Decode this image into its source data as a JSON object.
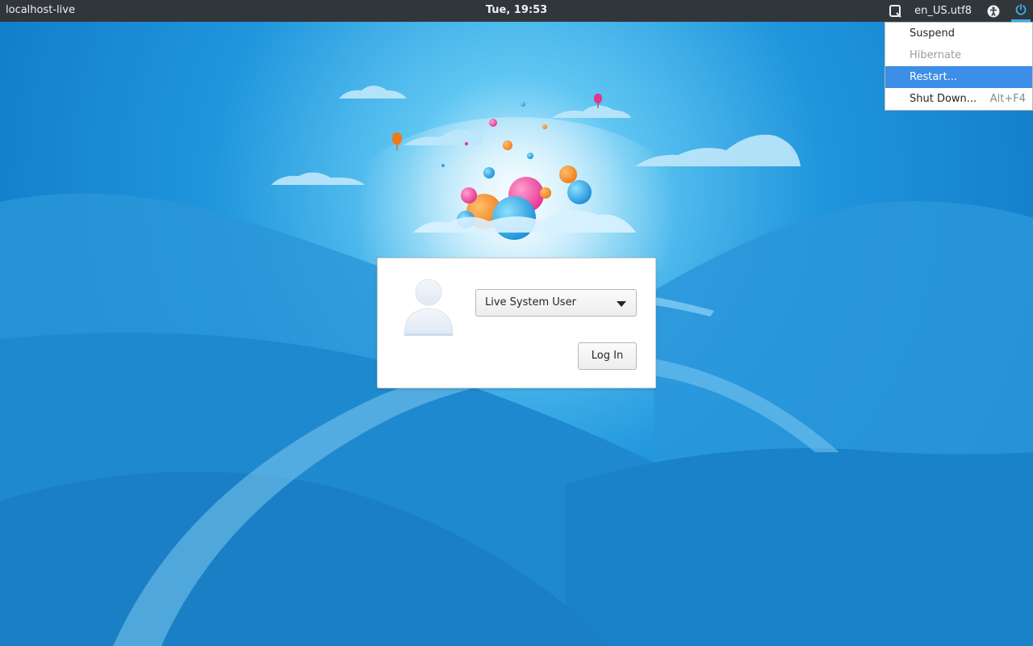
{
  "panel": {
    "hostname": "localhost-live",
    "clock": "Tue, 19:53",
    "locale": "en_US.utf8",
    "icons": [
      "keyboard-layout-icon",
      "accessibility-icon",
      "power-icon"
    ]
  },
  "power_menu": {
    "items": [
      {
        "label": "Suspend",
        "enabled": true
      },
      {
        "label": "Hibernate",
        "enabled": false
      },
      {
        "label": "Restart...",
        "enabled": true,
        "highlighted": true
      },
      {
        "label": "Shut Down...",
        "accel": "Alt+F4",
        "enabled": true
      }
    ]
  },
  "login": {
    "selected_user": "Live System User",
    "login_button": "Log In"
  },
  "colors": {
    "panel_bg": "#31363b",
    "accent": "#3daee9",
    "menu_highlight": "#3d8ee6",
    "wallpaper_blue": "#1a8ad2"
  }
}
